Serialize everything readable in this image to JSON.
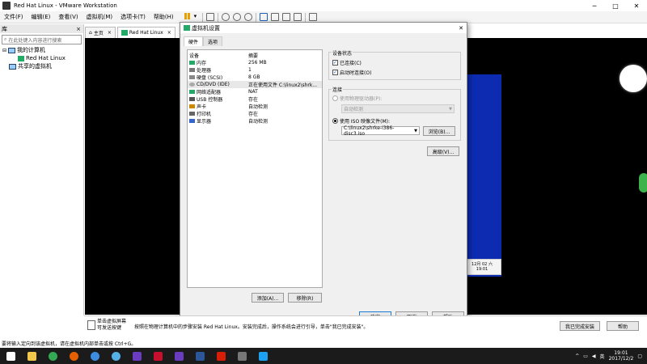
{
  "window": {
    "title": "Red Hat Linux - VMware Workstation"
  },
  "menu": [
    "文件(F)",
    "编辑(E)",
    "查看(V)",
    "虚拟机(M)",
    "选项卡(T)",
    "帮助(H)"
  ],
  "library": {
    "header": "库",
    "close": "×",
    "search_placeholder": "在此处键入内容进行搜索",
    "tree": {
      "my_computer": "我的计算机",
      "vm": "Red Hat Linux",
      "shared": "共享的虚拟机"
    }
  },
  "tabs": [
    {
      "label": "主页"
    },
    {
      "label": "Red Hat Linux"
    }
  ],
  "dialog": {
    "title": "虚拟机设置",
    "close": "✕",
    "tabs": [
      "硬件",
      "选项"
    ],
    "columns": {
      "device": "设备",
      "summary": "摘要"
    },
    "devices": [
      {
        "name": "内存",
        "summary": "256 MB"
      },
      {
        "name": "处理器",
        "summary": "1"
      },
      {
        "name": "硬盘 (SCSI)",
        "summary": "8 GB"
      },
      {
        "name": "CD/DVD (IDE)",
        "summary": "正在使用文件 C:\\linux2\\shrk..."
      },
      {
        "name": "网络适配器",
        "summary": "NAT"
      },
      {
        "name": "USB 控制器",
        "summary": "存在"
      },
      {
        "name": "声卡",
        "summary": "自动检测"
      },
      {
        "name": "打印机",
        "summary": "存在"
      },
      {
        "name": "显示器",
        "summary": "自动检测"
      }
    ],
    "add_button": "添加(A)...",
    "remove_button": "移除(R)",
    "device_status": {
      "title": "设备状态",
      "connected": "已连接(C)",
      "connect_on_power": "启动时连接(O)"
    },
    "connection": {
      "title": "连接",
      "physical_label": "使用物理驱动器(P):",
      "physical_value": "自动检测",
      "iso_label": "使用 ISO 映像文件(M):",
      "iso_value": "C:\\linux2\\shrke-i386-disc3.iso",
      "browse": "浏览(B)..."
    },
    "advanced": "高级(V)...",
    "ok": "确定",
    "cancel": "取消",
    "help": "帮助"
  },
  "guest_clock": {
    "line1": "12月 02 六",
    "line2": "19:01"
  },
  "hint": {
    "text1": "单击虚拟屏幕可发送按键",
    "text2": "按照在物理计算机中的步骤安装 Red Hat Linux。安装完成后，操作系统会进行引导，单击\"我已完成安装\"。",
    "done": "我已完成安装",
    "help": "帮助"
  },
  "statusbar": "要将输入定向到该虚拟机，请在虚拟机内部单击或按 Ctrl+G。",
  "taskbar": {
    "ime": "英",
    "time": "19:01",
    "date": "2017/12/2",
    "apps": [
      {
        "name": "start",
        "color": "#ffffff"
      },
      {
        "name": "explorer",
        "color": "#f2c84b"
      },
      {
        "name": "chrome",
        "color": "#34a853"
      },
      {
        "name": "firefox",
        "color": "#e66000"
      },
      {
        "name": "app-s",
        "color": "#3c8de0"
      },
      {
        "name": "cloud",
        "color": "#56b0e8"
      },
      {
        "name": "app-purple1",
        "color": "#6a3cc0"
      },
      {
        "name": "app-red",
        "color": "#c8102e"
      },
      {
        "name": "app-purple2",
        "color": "#6a3cc0"
      },
      {
        "name": "word",
        "color": "#2b579a"
      },
      {
        "name": "netease",
        "color": "#d81e06"
      },
      {
        "name": "vmware",
        "color": "#777777"
      },
      {
        "name": "app-bird",
        "color": "#1da1f2"
      }
    ]
  }
}
